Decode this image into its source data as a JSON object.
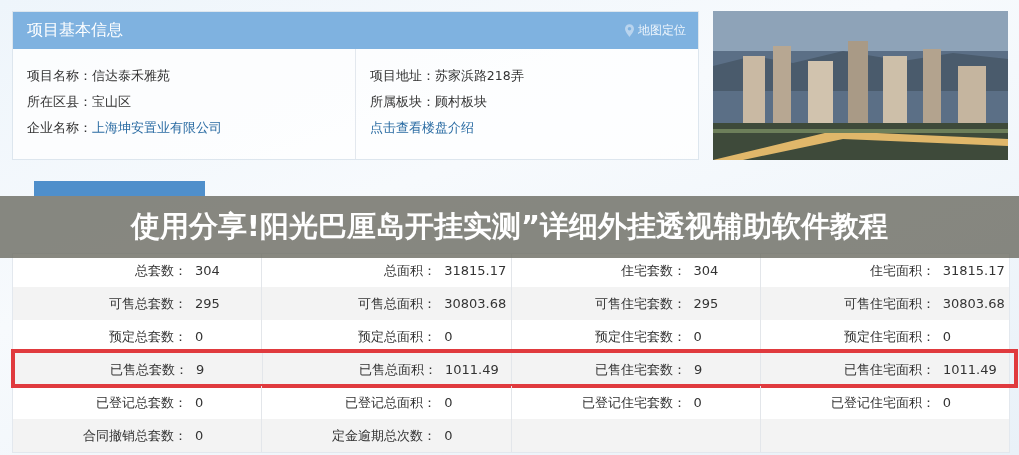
{
  "project_info": {
    "title": "项目基本信息",
    "map_link": "地图定位",
    "columns": [
      [
        {
          "label": "项目名称：",
          "value": "信达泰禾雅苑",
          "kind": "text"
        },
        {
          "label": "所在区县：",
          "value": "宝山区",
          "kind": "text"
        },
        {
          "label": "企业名称：",
          "value": "上海坤安置业有限公司",
          "kind": "link"
        }
      ],
      [
        {
          "label": "项目地址：",
          "value": "苏家浜路218弄",
          "kind": "text"
        },
        {
          "label": "所属板块：",
          "value": "顾村板块",
          "kind": "text"
        },
        {
          "value": "点击查看楼盘介绍",
          "kind": "link"
        }
      ]
    ]
  },
  "sales": {
    "tabs": [
      {
        "selected": true
      }
    ],
    "rows": [
      {
        "highlighted": false,
        "cells": [
          {
            "label": "总套数：",
            "value": "304"
          },
          {
            "label": "总面积：",
            "value": "31815.17"
          },
          {
            "label": "住宅套数：",
            "value": "304"
          },
          {
            "label": "住宅面积：",
            "value": "31815.17"
          }
        ]
      },
      {
        "highlighted": false,
        "cells": [
          {
            "label": "可售总套数：",
            "value": "295"
          },
          {
            "label": "可售总面积：",
            "value": "30803.68"
          },
          {
            "label": "可售住宅套数：",
            "value": "295"
          },
          {
            "label": "可售住宅面积：",
            "value": "30803.68"
          }
        ]
      },
      {
        "highlighted": false,
        "cells": [
          {
            "label": "预定总套数：",
            "value": "0"
          },
          {
            "label": "预定总面积：",
            "value": "0"
          },
          {
            "label": "预定住宅套数：",
            "value": "0"
          },
          {
            "label": "预定住宅面积：",
            "value": "0"
          }
        ]
      },
      {
        "highlighted": true,
        "cells": [
          {
            "label": "已售总套数：",
            "value": "9"
          },
          {
            "label": "已售总面积：",
            "value": "1011.49"
          },
          {
            "label": "已售住宅套数：",
            "value": "9"
          },
          {
            "label": "已售住宅面积：",
            "value": "1011.49"
          }
        ]
      },
      {
        "highlighted": false,
        "cells": [
          {
            "label": "已登记总套数：",
            "value": "0"
          },
          {
            "label": "已登记总面积：",
            "value": "0"
          },
          {
            "label": "已登记住宅套数：",
            "value": "0"
          },
          {
            "label": "已登记住宅面积：",
            "value": "0"
          }
        ]
      },
      {
        "highlighted": false,
        "cells": [
          {
            "label": "合同撤销总套数：",
            "value": "0"
          },
          {
            "label": "定金逾期总次数：",
            "value": "0"
          }
        ]
      }
    ]
  },
  "caption_banner": {
    "text": "使用分享!阳光巴厘岛开挂实测”详细外挂透视辅助软件教程"
  }
}
